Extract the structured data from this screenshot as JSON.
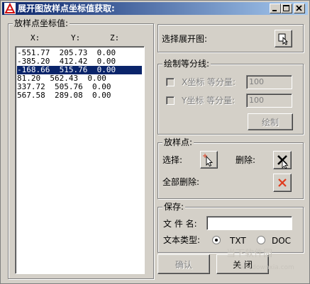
{
  "window": {
    "title": "展开图放样点坐标值获取:",
    "buttons": [
      "minimize",
      "maximize",
      "close"
    ]
  },
  "coords_group": {
    "title": "放样点坐标值:",
    "headers": [
      "X:",
      "Y:",
      "Z:"
    ],
    "rows": [
      "-551.77  205.73  0.00",
      "-385.20  412.42  0.00",
      "-168.66  515.76  0.00",
      "81.20  562.43  0.00",
      "337.72  505.76  0.00",
      "567.58  289.08  0.00"
    ],
    "selected_index": 2
  },
  "select_drawing": {
    "label": "选择展开图:",
    "icon": "select-pointer-icon"
  },
  "contour": {
    "title": "绘制等分线:",
    "x_label": "X坐标  等分量:",
    "x_value": "100",
    "y_label": "Y坐标  等分量:",
    "y_value": "100",
    "draw_button": "绘制"
  },
  "points": {
    "title": "放样点:",
    "select_label": "选择:",
    "delete_label": "删除:",
    "delete_all_label": "全部删除:"
  },
  "save": {
    "title": "保存:",
    "filename_label": "文 件 名:",
    "filename_value": "",
    "filetype_label": "文本类型:",
    "option_txt": "TXT",
    "option_doc": "DOC",
    "selected": "TXT"
  },
  "footer": {
    "ok_button": "确认",
    "close_button": "关 闭"
  },
  "watermark": {
    "text1": "当下软件园",
    "text2": "www.downxia.com"
  },
  "colors": {
    "title_gradient_start": "#0a246a",
    "title_gradient_end": "#a6caf0",
    "face": "#d4d0c8",
    "selection": "#0a246a",
    "delete_red": "#e03c1e"
  }
}
